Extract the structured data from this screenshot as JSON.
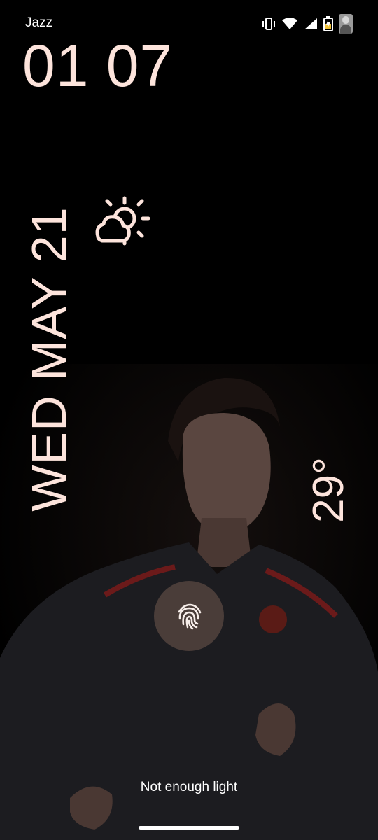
{
  "status_bar": {
    "carrier": "Jazz",
    "icons": [
      "vibrate-icon",
      "wifi-icon",
      "signal-icon",
      "battery-charging-icon",
      "profile-avatar"
    ]
  },
  "lockscreen": {
    "time": "01 07",
    "date": "WED MAY 21",
    "weather_icon": "partly-cloudy-icon",
    "temperature": "29°",
    "fingerprint_icon": "fingerprint-icon",
    "hint": "Not enough light"
  },
  "colors": {
    "text_accent": "#fde4dc",
    "background": "#000000",
    "fingerprint_bg": "#4e403c"
  }
}
